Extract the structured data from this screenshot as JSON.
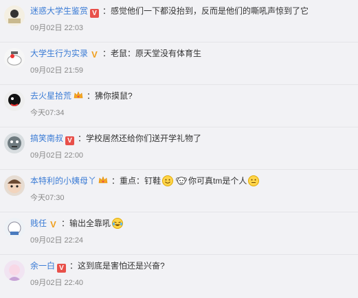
{
  "comments": [
    {
      "user": "迷惑大学生鉴赏",
      "badge": "V",
      "text": "感觉他们一下都没抬到，反而是他们的嘶吼声惊到了它",
      "time": "09月02日 22:03"
    },
    {
      "user": "大学生行为实录",
      "badge": "V",
      "text": "老鼠：原天堂没有体育生",
      "time": "09月02日 21:59"
    },
    {
      "user": "去火星拾荒",
      "badge": "crown",
      "text": "狒你摸鼠?",
      "time": "今天07:34"
    },
    {
      "user": "搞笑南叔",
      "badge": "V",
      "text": "学校居然还给你们送开学礼物了",
      "time": "09月02日 22:00"
    },
    {
      "user": "本特利的小姨母丫",
      "badge": "crown",
      "text_a": "重点：钉鞋",
      "text_b": "你可真tm是个人",
      "time": "今天07:30"
    },
    {
      "user": "贱任",
      "badge": "V",
      "text": "输出全靠吼",
      "time": "09月02日 22:24"
    },
    {
      "user": "余一白",
      "badge": "V",
      "text": "这到底是害怕还是兴奋?",
      "time": "09月02日 22:40"
    }
  ],
  "colors": {
    "username": "#3a7bd5",
    "badge_red": "#e8504a",
    "badge_gold": "#f0a020",
    "time": "#888888"
  },
  "icons": [
    "verified-red-v-icon",
    "verified-gold-v-icon",
    "vip-crown-icon",
    "smile-emoji-icon",
    "monkey-face-icon",
    "laugh-cry-emoji-icon"
  ]
}
